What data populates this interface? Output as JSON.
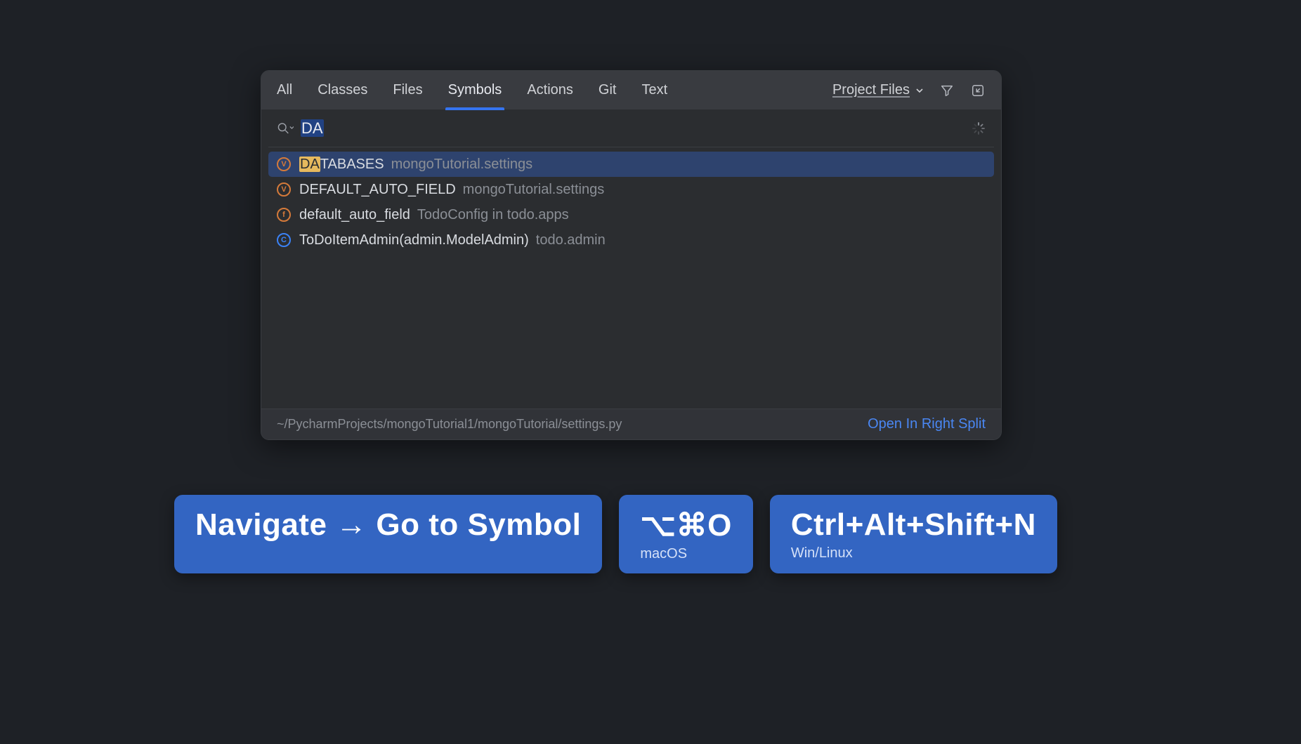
{
  "tabs": {
    "items": [
      "All",
      "Classes",
      "Files",
      "Symbols",
      "Actions",
      "Git",
      "Text"
    ],
    "active_index": 3
  },
  "scope": {
    "label": "Project Files"
  },
  "search": {
    "query": "DA"
  },
  "results": [
    {
      "badge": "V",
      "badge_class": "v",
      "name_hl": "DA",
      "name_rest": "TABASES",
      "location": "mongoTutorial.settings",
      "selected": true
    },
    {
      "badge": "V",
      "badge_class": "v",
      "name_hl": "",
      "name_rest": "DEFAULT_AUTO_FIELD",
      "location": "mongoTutorial.settings",
      "selected": false
    },
    {
      "badge": "f",
      "badge_class": "f",
      "name_hl": "",
      "name_rest": "default_auto_field",
      "location": "TodoConfig in todo.apps",
      "selected": false
    },
    {
      "badge": "C",
      "badge_class": "c",
      "name_hl": "",
      "name_rest": "ToDoItemAdmin(admin.ModelAdmin)",
      "location": "todo.admin",
      "selected": false
    }
  ],
  "footer": {
    "path": "~/PycharmProjects/mongoTutorial1/mongoTutorial/settings.py",
    "action": "Open In Right Split"
  },
  "cards": {
    "menu": "Navigate → Go to Symbol",
    "mac": {
      "keys": "⌥⌘O",
      "label": "macOS"
    },
    "win": {
      "keys": "Ctrl+Alt+Shift+N",
      "label": "Win/Linux"
    }
  }
}
